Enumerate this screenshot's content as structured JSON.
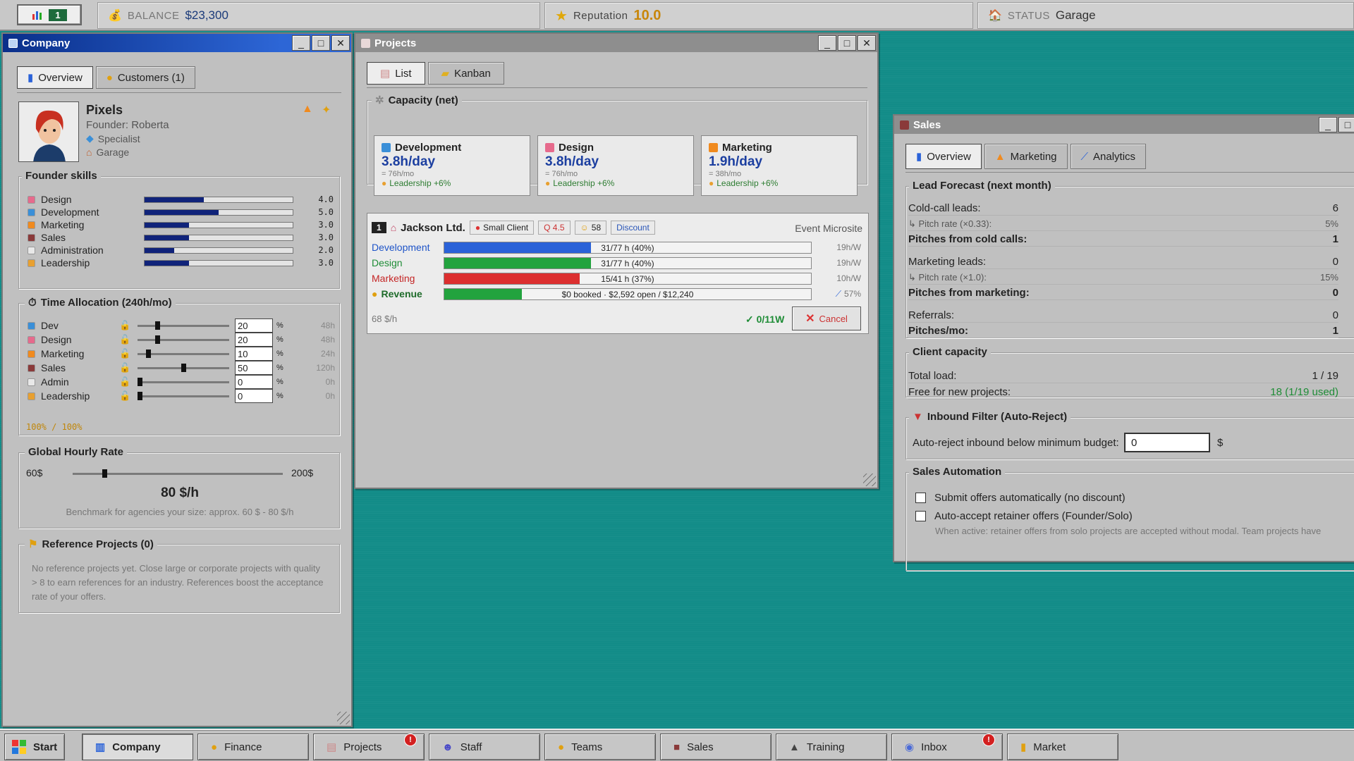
{
  "topbar": {
    "level": "1",
    "balance_label": "BALANCE",
    "balance_value": "$23,300",
    "reputation_label": "Reputation",
    "reputation_value": "10.0",
    "status_label": "STATUS",
    "status_value": "Garage"
  },
  "company": {
    "title": "Company",
    "tabs": [
      "Overview",
      "Customers (1)"
    ],
    "name": "Pixels",
    "founder": "Founder: Roberta",
    "role": "Specialist",
    "location": "Garage",
    "skills_title": "Founder skills",
    "skills": [
      {
        "name": "Design",
        "value": "4.0",
        "level": 0.4,
        "icon_color": "#e66a8c"
      },
      {
        "name": "Development",
        "value": "5.0",
        "level": 0.5,
        "icon_color": "#3a8fd8"
      },
      {
        "name": "Marketing",
        "value": "3.0",
        "level": 0.3,
        "icon_color": "#f08a1e"
      },
      {
        "name": "Sales",
        "value": "3.0",
        "level": 0.3,
        "icon_color": "#8a3a3a"
      },
      {
        "name": "Administration",
        "value": "2.0",
        "level": 0.2,
        "icon_color": "#e8e8e8"
      },
      {
        "name": "Leadership",
        "value": "3.0",
        "level": 0.3,
        "icon_color": "#e8a030"
      }
    ],
    "time_title": "Time Allocation (240h/mo)",
    "allocations": [
      {
        "name": "Dev",
        "value": "20",
        "percent": 0.2,
        "hours": "48h",
        "icon_color": "#3a8fd8"
      },
      {
        "name": "Design",
        "value": "20",
        "percent": 0.2,
        "hours": "48h",
        "icon_color": "#e66a8c"
      },
      {
        "name": "Marketing",
        "value": "10",
        "percent": 0.1,
        "hours": "24h",
        "icon_color": "#f08a1e"
      },
      {
        "name": "Sales",
        "value": "50",
        "percent": 0.5,
        "hours": "120h",
        "icon_color": "#8a3a3a"
      },
      {
        "name": "Admin",
        "value": "0",
        "percent": 0,
        "hours": "0h",
        "icon_color": "#e8e8e8"
      },
      {
        "name": "Leadership",
        "value": "0",
        "percent": 0,
        "hours": "0h",
        "icon_color": "#e8a030"
      }
    ],
    "alloc_total": "100% / 100%",
    "rate_title": "Global Hourly Rate",
    "rate_min": "60$",
    "rate_max": "200$",
    "rate_value": "80 $/h",
    "rate_level": 0.143,
    "rate_benchmark": "Benchmark for agencies your size: approx. 60 $ - 80 $/h",
    "ref_title": "Reference Projects (0)",
    "ref_text": "No reference projects yet. Close large or corporate projects with quality > 8 to earn references for an industry. References boost the acceptance rate of your offers."
  },
  "projects": {
    "title": "Projects",
    "tabs": [
      "List",
      "Kanban"
    ],
    "capacity_title": "Capacity (net)",
    "capacity": [
      {
        "name": "Development",
        "rate": "3.8h/day",
        "sub": "= 76h/mo",
        "lead": "Leadership +6%",
        "icon_color": "#3a8fd8"
      },
      {
        "name": "Design",
        "rate": "3.8h/day",
        "sub": "= 76h/mo",
        "lead": "Leadership +6%",
        "icon_color": "#e66a8c"
      },
      {
        "name": "Marketing",
        "rate": "1.9h/day",
        "sub": "= 38h/mo",
        "lead": "Leadership +6%",
        "icon_color": "#f08a1e"
      }
    ],
    "project": {
      "num": "1",
      "client": "Jackson Ltd.",
      "chips": [
        "Small Client",
        "Q 4.5",
        "58",
        "Discount"
      ],
      "type": "Event Microsite",
      "rows": [
        {
          "label": "Development",
          "text": "31/77 h (40%)",
          "fill": 0.4,
          "right": "19h/W",
          "color": "#2a62d8",
          "label_color": "#1e54c8"
        },
        {
          "label": "Design",
          "text": "31/77 h (40%)",
          "fill": 0.4,
          "right": "19h/W",
          "color": "#22a33e",
          "label_color": "#1e8c36"
        },
        {
          "label": "Marketing",
          "text": "15/41 h (37%)",
          "fill": 0.37,
          "right": "10h/W",
          "color": "#dc2f2f",
          "label_color": "#c42424"
        },
        {
          "label": "Revenue",
          "text": "$0 booked · $2,592 open / $12,240",
          "fill": 0.212,
          "right": "57%",
          "color": "#22a33e",
          "label_color": "#1e6b2a"
        }
      ],
      "rate": "68 $/h",
      "progress": "✓ 0/11W",
      "cancel": "Cancel"
    }
  },
  "sales": {
    "title": "Sales",
    "tabs": [
      "Overview",
      "Marketing",
      "Analytics"
    ],
    "forecast_title": "Lead Forecast (next month)",
    "forecast": [
      {
        "label": "Cold-call leads:",
        "value": "6",
        "style": "n"
      },
      {
        "label": "↳ Pitch rate (×0.33):",
        "value": "5%",
        "style": "small"
      },
      {
        "label": "Pitches from cold calls:",
        "value": "1",
        "style": "b"
      },
      {
        "label": "Marketing leads:",
        "value": "0",
        "style": "n"
      },
      {
        "label": "↳ Pitch rate (×1.0):",
        "value": "15%",
        "style": "small"
      },
      {
        "label": "Pitches from marketing:",
        "value": "0",
        "style": "b"
      },
      {
        "label": "Referrals:",
        "value": "0",
        "style": "n"
      },
      {
        "label": "Pitches/mo:",
        "value": "1",
        "style": "b"
      }
    ],
    "capacity_title": "Client capacity",
    "total_load_label": "Total load:",
    "total_load_value": "1 / 19",
    "free_label": "Free for new projects:",
    "free_value": "18 (1/19 used)",
    "inbound_title": "Inbound Filter (Auto-Reject)",
    "inbound_label": "Auto-reject inbound below minimum budget:",
    "inbound_value": "0",
    "inbound_unit": "$",
    "automation_title": "Sales Automation",
    "auto_submit": "Submit offers automatically (no discount)",
    "auto_accept": "Auto-accept retainer offers (Founder/Solo)",
    "auto_note": "When active: retainer offers from solo projects are accepted without modal. Team projects have"
  },
  "taskbar": {
    "start": "Start",
    "items": [
      "Company",
      "Finance",
      "Projects",
      "Staff",
      "Teams",
      "Sales",
      "Training",
      "Inbox",
      "Market"
    ],
    "projects_badge": "!",
    "inbox_badge": "!"
  },
  "colors": {
    "desktop": "#128c88",
    "titlebar_active": "#0a2f8a",
    "bar_fill": "#10237a"
  }
}
